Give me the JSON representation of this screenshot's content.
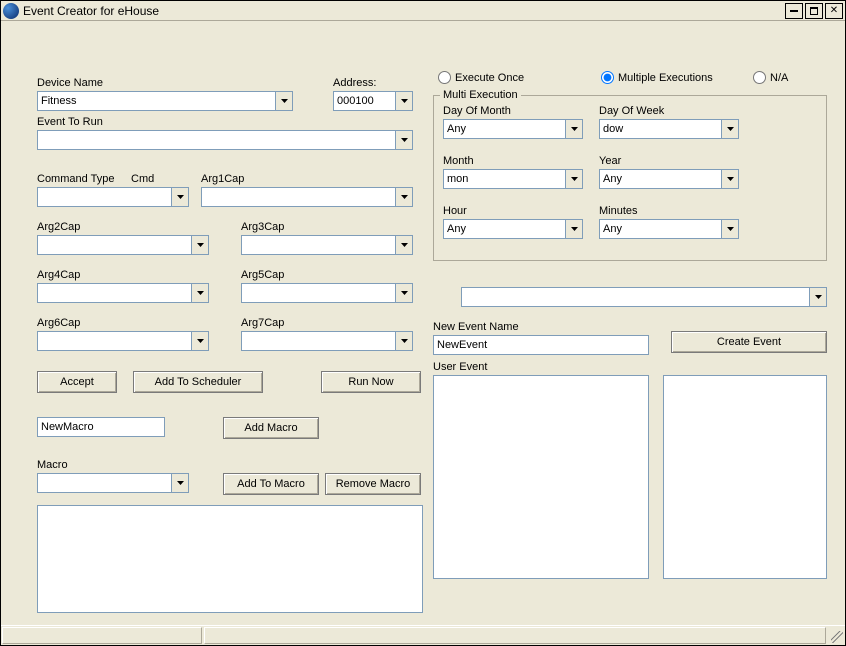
{
  "window": {
    "title": "Event Creator for eHouse"
  },
  "labels": {
    "deviceName": "Device Name",
    "address": "Address:",
    "eventToRun": "Event To Run",
    "commandType": "Command Type",
    "cmd": "Cmd",
    "arg1": "Arg1Cap",
    "arg2": "Arg2Cap",
    "arg3": "Arg3Cap",
    "arg4": "Arg4Cap",
    "arg5": "Arg5Cap",
    "arg6": "Arg6Cap",
    "arg7": "Arg7Cap",
    "macro": "Macro",
    "newEventName": "New Event Name",
    "userEvent": "User Event"
  },
  "values": {
    "deviceName": "Fitness",
    "address": "000100",
    "eventToRun": "",
    "commandType": "",
    "arg1": "",
    "arg2": "",
    "arg3": "",
    "arg4": "",
    "arg5": "",
    "arg6": "",
    "arg7": "",
    "newMacro": "NewMacro",
    "macro": "",
    "newEventName": "NewEvent",
    "bottomSelect": ""
  },
  "buttons": {
    "accept": "Accept",
    "addToScheduler": "Add To Scheduler",
    "runNow": "Run Now",
    "addMacro": "Add Macro",
    "addToMacro": "Add To Macro",
    "removeMacro": "Remove Macro",
    "createEvent": "Create Event"
  },
  "radios": {
    "executeOnce": "Execute Once",
    "multiple": "Multiple Executions",
    "na": "N/A",
    "selected": "multiple"
  },
  "multi": {
    "legend": "Multi Execution",
    "labels": {
      "dayOfMonth": "Day Of Month",
      "dayOfWeek": "Day Of Week",
      "month": "Month",
      "year": "Year",
      "hour": "Hour",
      "minutes": "Minutes"
    },
    "values": {
      "dayOfMonth": "Any",
      "dayOfWeek": "dow",
      "month": "mon",
      "year": "Any",
      "hour": "Any",
      "minutes": "Any"
    }
  }
}
